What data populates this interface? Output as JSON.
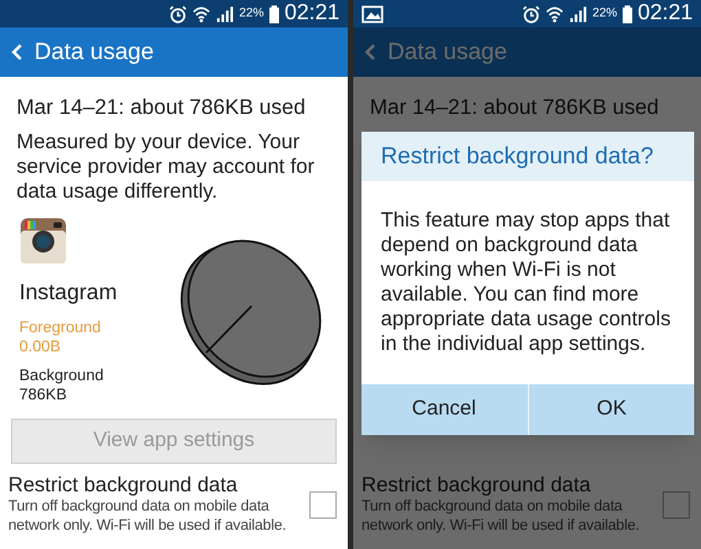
{
  "screens": [
    {
      "dimmed": false,
      "status_bar": {
        "notification_icon": false,
        "battery": "22%",
        "time": "02:21"
      },
      "app_bar": {
        "title": "Data usage"
      },
      "summary": "Mar 14–21: about 786KB used",
      "note": "Measured by your device. Your service provider may account for data usage differently.",
      "app": {
        "name": "Instagram",
        "foreground_label": "Foreground",
        "foreground_value": "0.00B",
        "background_label": "Background",
        "background_value": "786KB"
      },
      "view_button": "View app settings",
      "restrict": {
        "title": "Restrict background data",
        "description": "Turn off background data on mobile data network only. Wi-Fi will be used if available.",
        "checked": false
      }
    },
    {
      "dimmed": true,
      "status_bar": {
        "notification_icon": true,
        "battery": "22%",
        "time": "02:21"
      },
      "app_bar": {
        "title": "Data usage"
      },
      "summary": "Mar 14–21: about 786KB used",
      "restrict": {
        "title": "Restrict background data",
        "description": "Turn off background data on mobile data network only. Wi-Fi will be used if available.",
        "checked": false
      },
      "dialog": {
        "title": "Restrict background data?",
        "message": "This feature may stop apps that depend on background data working when Wi-Fi is not available. You can find more appropriate data usage controls in the individual app settings.",
        "buttons": [
          "Cancel",
          "OK"
        ]
      }
    }
  ]
}
